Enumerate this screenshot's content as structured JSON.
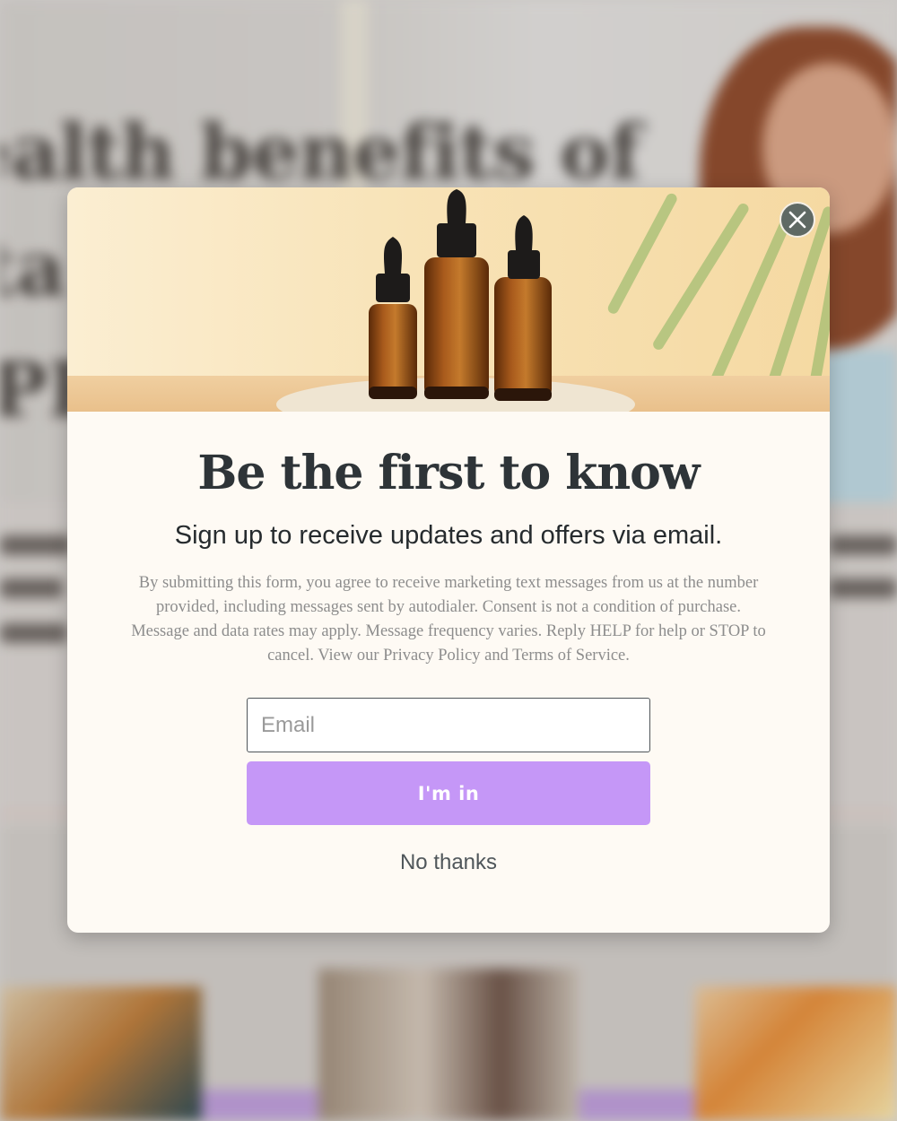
{
  "background": {
    "headline_fragment": "ealth benefits of"
  },
  "modal": {
    "close_label": "×",
    "title": "Be the first to know",
    "subtitle": "Sign up to receive updates and offers via email.",
    "disclaimer": "By submitting this form, you agree to receive marketing text messages from us at the number provided, including messages sent by autodialer. Consent is not a condition of purchase. Message and data rates may apply. Message frequency varies. Reply HELP for help or STOP to cancel. View our Privacy Policy and Terms of Service.",
    "email": {
      "placeholder": "Email",
      "value": ""
    },
    "submit_label": "I'm in",
    "decline_label": "No thanks",
    "hero_icon": "amber-dropper-bottles-image"
  },
  "colors": {
    "modal_background": "#fefaf4",
    "submit_button": "#c597f7",
    "title_text": "#2e3438",
    "close_button": "#5f6964"
  }
}
